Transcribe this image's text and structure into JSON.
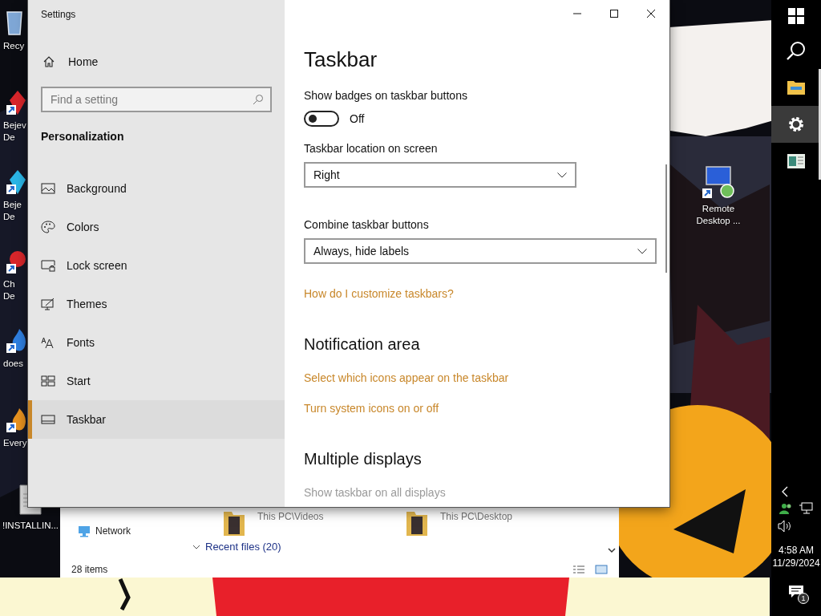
{
  "desktop": {
    "icons": [
      {
        "kind": "bin",
        "label_lines": [
          "Recy"
        ]
      },
      {
        "kind": "redgem",
        "label_lines": [
          "Bejev",
          "De"
        ]
      },
      {
        "kind": "bluegem",
        "label_lines": [
          "Beje",
          "De"
        ]
      },
      {
        "kind": "orb",
        "label_lines": [
          "Ch",
          "De"
        ]
      },
      {
        "kind": "blueflame",
        "label_lines": [
          "does"
        ]
      },
      {
        "kind": "orangeflame",
        "label_lines": [
          "Every"
        ]
      },
      {
        "kind": "file",
        "label_lines": [
          "!INSTALLIN..."
        ]
      }
    ],
    "right_icons": [
      {
        "kind": "remote",
        "label_lines": [
          "Remote",
          "Desktop ..."
        ]
      }
    ]
  },
  "explorer": {
    "nav": [
      {
        "label": "Network"
      }
    ],
    "items": [
      {
        "label": "This PC\\Videos"
      },
      {
        "label": "This PC\\Desktop"
      }
    ],
    "group": "Recent files (20)",
    "status": "28 items"
  },
  "settings_window": {
    "title": "Settings",
    "sidebar": {
      "home": "Home",
      "search": {
        "placeholder": "Find a setting"
      },
      "section": "Personalization",
      "items": [
        {
          "kind": "background",
          "label": "Background",
          "selected": false
        },
        {
          "kind": "colors",
          "label": "Colors",
          "selected": false
        },
        {
          "kind": "lock",
          "label": "Lock screen",
          "selected": false
        },
        {
          "kind": "themes",
          "label": "Themes",
          "selected": false
        },
        {
          "kind": "fonts",
          "label": "Fonts",
          "selected": false
        },
        {
          "kind": "start",
          "label": "Start",
          "selected": false
        },
        {
          "kind": "taskbar",
          "label": "Taskbar",
          "selected": true
        }
      ]
    },
    "page": {
      "title": "Taskbar",
      "content": [
        {
          "kind": "toggle",
          "label": "Show badges on taskbar buttons",
          "on": false,
          "disabled": false,
          "state_text": "Off"
        },
        {
          "kind": "dropdown",
          "label": "Taskbar location on screen",
          "value": "Right"
        },
        {
          "kind": "dropdown",
          "label": "Combine taskbar buttons",
          "value": "Always, hide labels"
        },
        {
          "kind": "link",
          "text": "How do I customize taskbars?"
        },
        {
          "kind": "heading",
          "text": "Notification area"
        },
        {
          "kind": "link",
          "text": "Select which icons appear on the taskbar"
        },
        {
          "kind": "link",
          "text": "Turn system icons on or off"
        },
        {
          "kind": "heading",
          "text": "Multiple displays"
        },
        {
          "kind": "toggle",
          "label": "Show taskbar on all displays",
          "disabled": true
        }
      ]
    }
  },
  "taskbar": {
    "apps": [
      {
        "kind": "start",
        "selected": false,
        "running": false
      },
      {
        "kind": "search",
        "selected": false,
        "running": false
      },
      {
        "kind": "explorer",
        "selected": false,
        "running": true
      },
      {
        "kind": "settings",
        "selected": true,
        "running": true
      },
      {
        "kind": "app",
        "selected": false,
        "running": true
      }
    ],
    "tray": {
      "time": "4:58 AM",
      "date": "11/29/2024",
      "notifications": "1"
    }
  }
}
